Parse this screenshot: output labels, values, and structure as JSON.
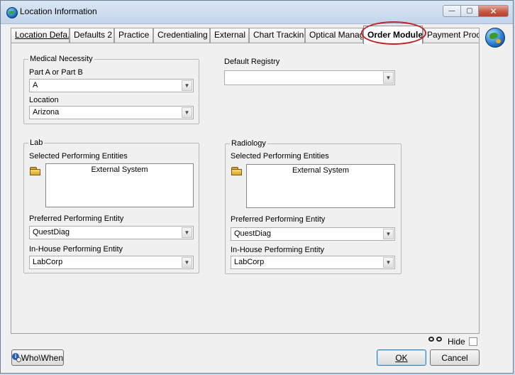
{
  "window": {
    "title": "Location Information",
    "close_glyph": "✕",
    "minimize_glyph": "—",
    "maximize_glyph": "▢"
  },
  "tabs": [
    {
      "label": "Location Defa..."
    },
    {
      "label": "Defaults 2"
    },
    {
      "label": "Practice"
    },
    {
      "label": "Credentialing"
    },
    {
      "label": "External"
    },
    {
      "label": "Chart Tracking"
    },
    {
      "label": "Optical Manag..."
    },
    {
      "label": "Order Module",
      "active": true
    },
    {
      "label": "Payment Proc..."
    }
  ],
  "medical_necessity": {
    "legend": "Medical Necessity",
    "part_label": "Part A or Part B",
    "part_value": "A",
    "location_label": "Location",
    "location_value": "Arizona"
  },
  "default_registry": {
    "label": "Default Registry",
    "value": ""
  },
  "lab": {
    "legend": "Lab",
    "selected_label": "Selected Performing Entities",
    "selected_items": [
      "External System"
    ],
    "preferred_label": "Preferred Performing Entity",
    "preferred_value": "QuestDiag",
    "inhouse_label": "In-House Performing Entity",
    "inhouse_value": "LabCorp"
  },
  "radiology": {
    "legend": "Radiology",
    "selected_label": "Selected Performing Entities",
    "selected_items": [
      "External System"
    ],
    "preferred_label": "Preferred Performing Entity",
    "preferred_value": "QuestDiag",
    "inhouse_label": "In-House Performing Entity",
    "inhouse_value": "LabCorp"
  },
  "footer": {
    "whowhen_label": "Who\\When",
    "hide_label": "Hide",
    "hide_checked": false,
    "ok_label": "OK",
    "cancel_label": "Cancel"
  },
  "colors": {
    "active_tab_highlight": "#c0202a",
    "window_bg": "#f0f0f0"
  }
}
